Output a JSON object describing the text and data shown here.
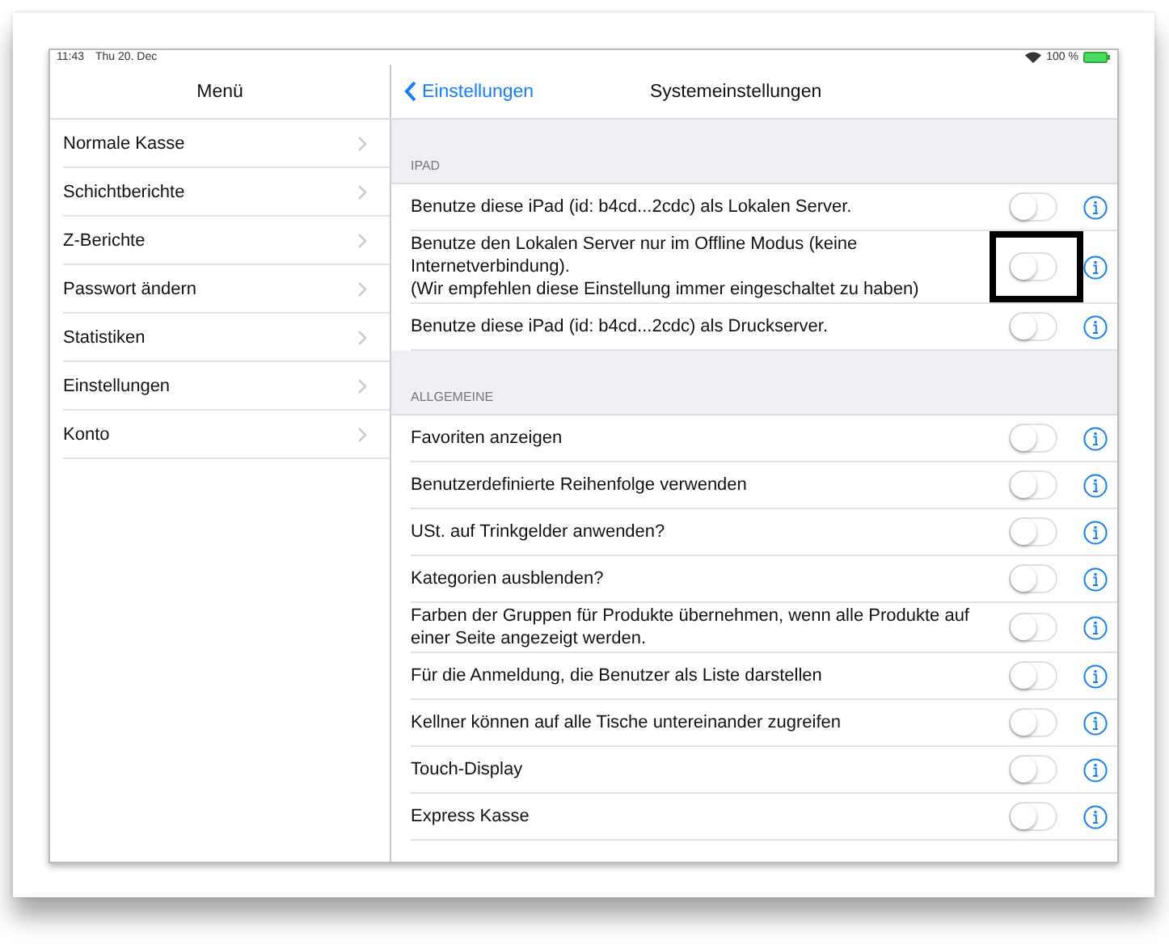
{
  "status_bar": {
    "time": "11:43",
    "date": "Thu 20. Dec",
    "battery": "100 %"
  },
  "sidebar": {
    "title": "Menü",
    "items": [
      {
        "label": "Normale Kasse"
      },
      {
        "label": "Schichtberichte"
      },
      {
        "label": "Z-Berichte"
      },
      {
        "label": "Passwort ändern"
      },
      {
        "label": "Statistiken"
      },
      {
        "label": "Einstellungen"
      },
      {
        "label": "Konto"
      }
    ]
  },
  "nav": {
    "back": "Einstellungen",
    "title": "Systemeinstellungen"
  },
  "sections": [
    {
      "header": "IPAD",
      "settings": [
        {
          "label": "Benutze diese iPad (id: b4cd...2cdc) als Lokalen Server.",
          "on": false,
          "highlighted": false
        },
        {
          "label": "Benutze den Lokalen Server nur im Offline Modus (keine\nInternetverbindung).\n(Wir empfehlen diese Einstellung immer eingeschaltet zu haben)",
          "on": false,
          "highlighted": true
        },
        {
          "label": "Benutze diese iPad (id: b4cd...2cdc) als Druckserver.",
          "on": false,
          "highlighted": false
        }
      ]
    },
    {
      "header": "ALLGEMEINE",
      "settings": [
        {
          "label": "Favoriten anzeigen",
          "on": false,
          "highlighted": false
        },
        {
          "label": "Benutzerdefinierte Reihenfolge verwenden",
          "on": false,
          "highlighted": false
        },
        {
          "label": "USt. auf Trinkgelder anwenden?",
          "on": false,
          "highlighted": false
        },
        {
          "label": "Kategorien ausblenden?",
          "on": false,
          "highlighted": false
        },
        {
          "label": "Farben der Gruppen für Produkte übernehmen, wenn alle Produkte auf\neiner Seite angezeigt werden.",
          "on": false,
          "highlighted": false
        },
        {
          "label": "Für die Anmeldung, die Benutzer als Liste darstellen",
          "on": false,
          "highlighted": false
        },
        {
          "label": "Kellner können auf alle Tische untereinander zugreifen",
          "on": false,
          "highlighted": false
        },
        {
          "label": "Touch-Display",
          "on": false,
          "highlighted": false
        },
        {
          "label": "Express Kasse",
          "on": false,
          "highlighted": false
        }
      ]
    }
  ]
}
